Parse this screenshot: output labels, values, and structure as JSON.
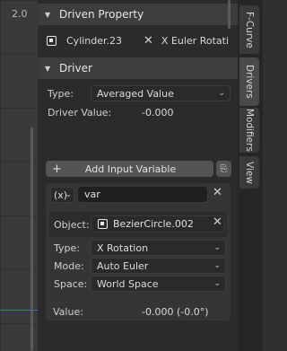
{
  "graph": {
    "frame": "2.0"
  },
  "driven_property": {
    "title": "Driven Property",
    "object": "Cylinder.23",
    "property": "X Euler Rotati..."
  },
  "driver": {
    "title": "Driver",
    "type_label": "Type:",
    "type_value": "Averaged Value",
    "value_label": "Driver Value:",
    "value": "-0.000"
  },
  "add_variable": {
    "label": "Add Input Variable"
  },
  "variable": {
    "type_glyph": "(x)",
    "name": "var",
    "object_label": "Object:",
    "object": "BezierCircle.002",
    "type_label": "Type:",
    "type_value": "X Rotation",
    "mode_label": "Mode:",
    "mode_value": "Auto Euler",
    "space_label": "Space:",
    "space_value": "World Space",
    "value_label": "Value:",
    "value": "-0.000 (-0.0°)"
  },
  "tabs": [
    "F-Curve",
    "Drivers",
    "Modifiers",
    "View"
  ],
  "active_tab": "Drivers"
}
